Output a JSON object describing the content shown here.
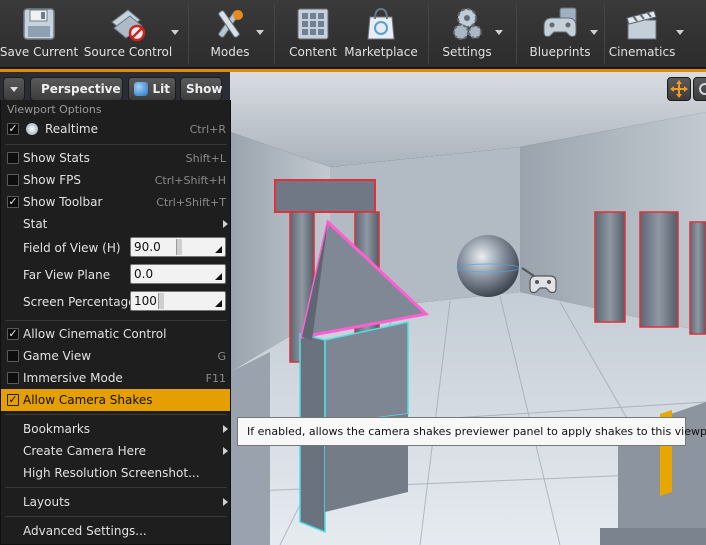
{
  "toolbar": {
    "buttons": [
      {
        "label": "Save Current",
        "icon": "floppy-disk-icon"
      },
      {
        "label": "Source Control",
        "icon": "source-control-icon"
      },
      {
        "label": "Modes",
        "icon": "modes-tools-icon"
      },
      {
        "label": "Content",
        "icon": "content-grid-icon"
      },
      {
        "label": "Marketplace",
        "icon": "marketplace-bag-icon"
      },
      {
        "label": "Settings",
        "icon": "gears-icon"
      },
      {
        "label": "Blueprints",
        "icon": "gamepad-icon"
      },
      {
        "label": "Cinematics",
        "icon": "clapperboard-icon"
      }
    ]
  },
  "viewport_toolbar": {
    "perspective_label": "Perspective",
    "lit_label": "Lit",
    "show_label": "Show"
  },
  "menu": {
    "header": "Viewport Options",
    "realtime": {
      "label": "Realtime",
      "shortcut": "Ctrl+R",
      "checked": true
    },
    "show_stats": {
      "label": "Show Stats",
      "shortcut": "Shift+L",
      "checked": false
    },
    "show_fps": {
      "label": "Show FPS",
      "shortcut": "Ctrl+Shift+H",
      "checked": false
    },
    "show_toolbar": {
      "label": "Show Toolbar",
      "shortcut": "Ctrl+Shift+T",
      "checked": true
    },
    "stat": {
      "label": "Stat"
    },
    "fov": {
      "label": "Field of View (H)",
      "value": "90.0"
    },
    "far_view": {
      "label": "Far View Plane",
      "value": "0.0"
    },
    "screen_pct": {
      "label": "Screen Percentage",
      "value": "100"
    },
    "cinematic": {
      "label": "Allow Cinematic Control",
      "checked": true
    },
    "game_view": {
      "label": "Game View",
      "shortcut": "G",
      "checked": false
    },
    "immersive": {
      "label": "Immersive Mode",
      "shortcut": "F11",
      "checked": false
    },
    "camera_shakes": {
      "label": "Allow Camera Shakes",
      "checked": true
    },
    "bookmarks": {
      "label": "Bookmarks"
    },
    "create_camera": {
      "label": "Create Camera Here"
    },
    "hires": {
      "label": "High Resolution Screenshot..."
    },
    "layouts": {
      "label": "Layouts"
    },
    "advanced": {
      "label": "Advanced Settings..."
    }
  },
  "tooltip": {
    "text": "If enabled, allows the camera shakes previewer panel to apply shakes to this viewport"
  },
  "colors": {
    "accent": "#e59f00",
    "selection_red": "#e0303a",
    "selection_pink": "#ff5fd2",
    "selection_cyan": "#4ee0e6"
  }
}
